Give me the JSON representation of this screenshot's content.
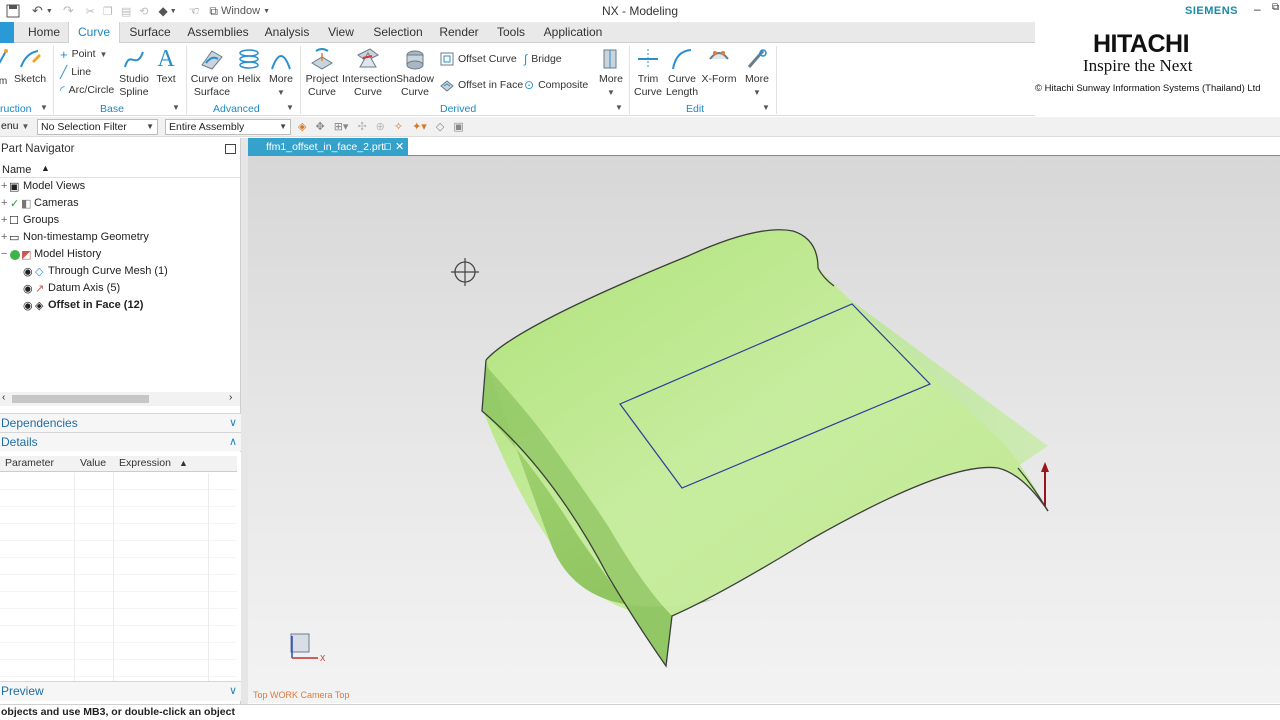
{
  "titlebar": {
    "window_menu": "Window",
    "app_title": "NX - Modeling",
    "brand": "SIEMENS"
  },
  "ribbon_tabs": [
    "Home",
    "Curve",
    "Surface",
    "Assemblies",
    "Analysis",
    "View",
    "Selection",
    "Render",
    "Tools",
    "Application"
  ],
  "active_tab": "Curve",
  "ribbon": {
    "construction": {
      "sketch": "Sketch",
      "group": "ruction"
    },
    "base": {
      "point": "Point",
      "line": "Line",
      "arc_circle": "Arc/Circle",
      "studio_spline_1": "Studio",
      "studio_spline_2": "Spline",
      "text": "Text",
      "group": "Base"
    },
    "advanced": {
      "curve_on_surface_1": "Curve on",
      "curve_on_surface_2": "Surface",
      "helix": "Helix",
      "more": "More",
      "group": "Advanced"
    },
    "derived": {
      "project_1": "Project",
      "project_2": "Curve",
      "intersection_1": "Intersection",
      "intersection_2": "Curve",
      "shadow_1": "Shadow",
      "shadow_2": "Curve",
      "offset_curve": "Offset Curve",
      "offset_in_face": "Offset in Face",
      "bridge": "Bridge",
      "composite": "Composite",
      "more": "More",
      "group": "Derived"
    },
    "edit": {
      "trim_1": "Trim",
      "trim_2": "Curve",
      "length_1": "Curve",
      "length_2": "Length",
      "xform": "X-Form",
      "more": "More",
      "group": "Edit"
    }
  },
  "logo": {
    "company": "HITACHI",
    "tagline": "Inspire the Next",
    "subsidiary": "© Hitachi Sunway Information Systems (Thailand) Ltd"
  },
  "selection_bar": {
    "menu": "enu",
    "filter": "No Selection Filter",
    "scope": "Entire Assembly"
  },
  "part_navigator": {
    "title": "Part Navigator",
    "column_name": "Name",
    "nodes": [
      {
        "label": "Model Views"
      },
      {
        "label": "Cameras"
      },
      {
        "label": "Groups"
      },
      {
        "label": "Non-timestamp Geometry"
      },
      {
        "label": "Model History"
      },
      {
        "label": "Through Curve Mesh (1)"
      },
      {
        "label": "Datum Axis (5)"
      },
      {
        "label": "Offset in Face (12)"
      }
    ]
  },
  "panels": {
    "dependencies": "Dependencies",
    "details": "Details",
    "preview": "Preview",
    "details_columns": [
      "Parameter",
      "Value",
      "Expression"
    ]
  },
  "document_tab": "ffm1_offset_in_face_2.prt",
  "viewport_label": "Top WORK Camera Top",
  "status_text": "objects and use MB3, or double-click an object",
  "colors": {
    "accent": "#1d87c4",
    "surface_fill": "#b9e58a",
    "curve": "#2c3e9a",
    "doc_tab": "#35a2cc"
  }
}
